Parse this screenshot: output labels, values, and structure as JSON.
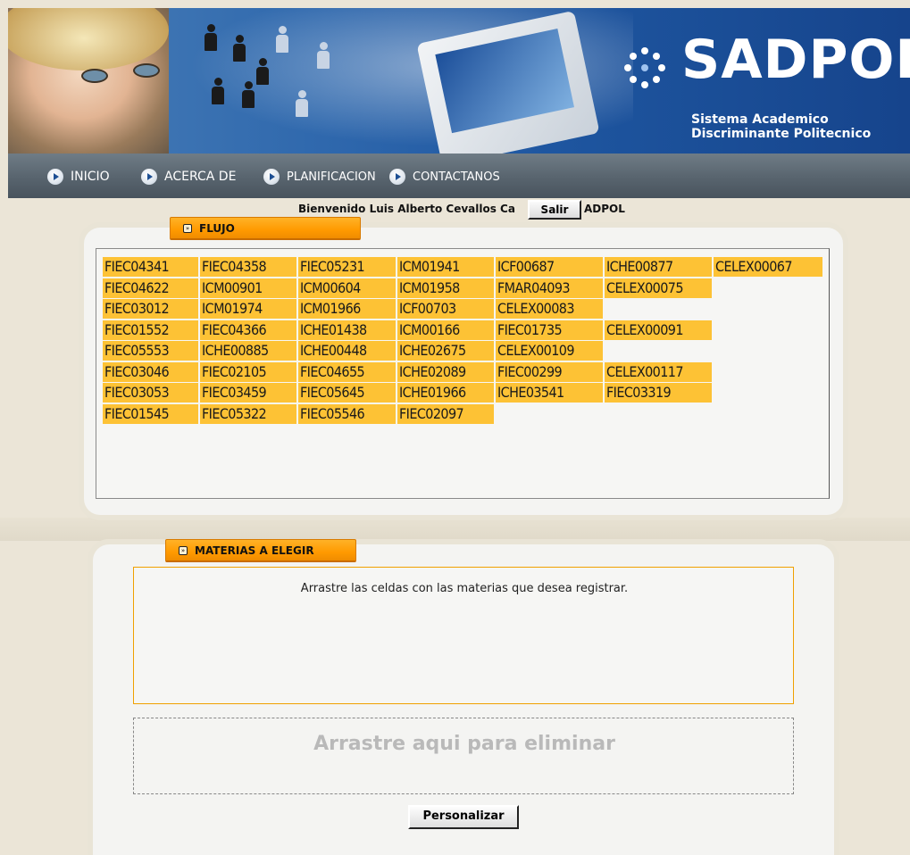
{
  "header": {
    "logo_title": "SADPOL",
    "logo_subtitle_1": "Sistema Academico",
    "logo_subtitle_2": "Discriminante Politecnico"
  },
  "nav": {
    "items": [
      {
        "label": "INICIO"
      },
      {
        "label": "ACERCA DE"
      },
      {
        "label": "PLANIFICACION"
      },
      {
        "label": "CONTACTANOS"
      }
    ]
  },
  "welcome": {
    "text": "Bienvenido Luis Alberto Cevallos Ca",
    "suffix": "ADPOL",
    "logout_label": "Salir"
  },
  "flujo": {
    "tab_label": "FLUJO",
    "rows": [
      [
        "FIEC04341",
        "FIEC04358",
        "FIEC05231",
        "ICM01941",
        "ICF00687",
        "ICHE00877",
        "CELEX00067"
      ],
      [
        "FIEC04622",
        "ICM00901",
        "ICM00604",
        "ICM01958",
        "FMAR04093",
        "CELEX00075"
      ],
      [
        "FIEC03012",
        "ICM01974",
        "ICM01966",
        "ICF00703",
        "CELEX00083"
      ],
      [
        "FIEC01552",
        "FIEC04366",
        "ICHE01438",
        "ICM00166",
        "FIEC01735",
        "CELEX00091"
      ],
      [
        "FIEC05553",
        "ICHE00885",
        "ICHE00448",
        "ICHE02675",
        "CELEX00109"
      ],
      [
        "FIEC03046",
        "FIEC02105",
        "FIEC04655",
        "ICHE02089",
        "FIEC00299",
        "CELEX00117"
      ],
      [
        "FIEC03053",
        "FIEC03459",
        "FIEC05645",
        "ICHE01966",
        "ICHE03541",
        "FIEC03319"
      ],
      [
        "FIEC01545",
        "FIEC05322",
        "FIEC05546",
        "FIEC02097"
      ]
    ]
  },
  "materias": {
    "tab_label": "MATERIAS A ELEGIR",
    "drop_instruction": "Arrastre las celdas con las materias que desea registrar.",
    "trash_label": "Arrastre aqui para eliminar",
    "button_label": "Personalizar"
  }
}
